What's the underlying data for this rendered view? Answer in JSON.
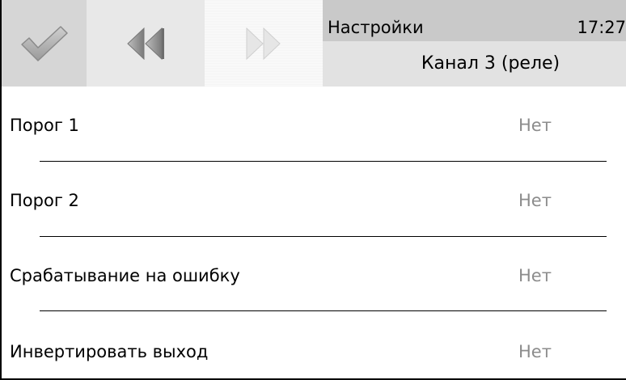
{
  "header": {
    "title": "Настройки",
    "clock": "17:27",
    "subtitle": "Канал 3 (реле)"
  },
  "toolbar": {
    "ok_icon": "checkmark-icon",
    "back_icon": "rewind-icon",
    "forward_icon": "fast-forward-icon"
  },
  "settings": [
    {
      "label": "Порог 1",
      "value": "Нет"
    },
    {
      "label": "Порог 2",
      "value": "Нет"
    },
    {
      "label": "Срабатывание на ошибку",
      "value": "Нет"
    },
    {
      "label": "Инвертировать выход",
      "value": "Нет"
    }
  ],
  "colors": {
    "value_text": "#8c8c8c",
    "title_bar": "#c9c9c9",
    "subtitle_bar": "#e2e2e2"
  }
}
